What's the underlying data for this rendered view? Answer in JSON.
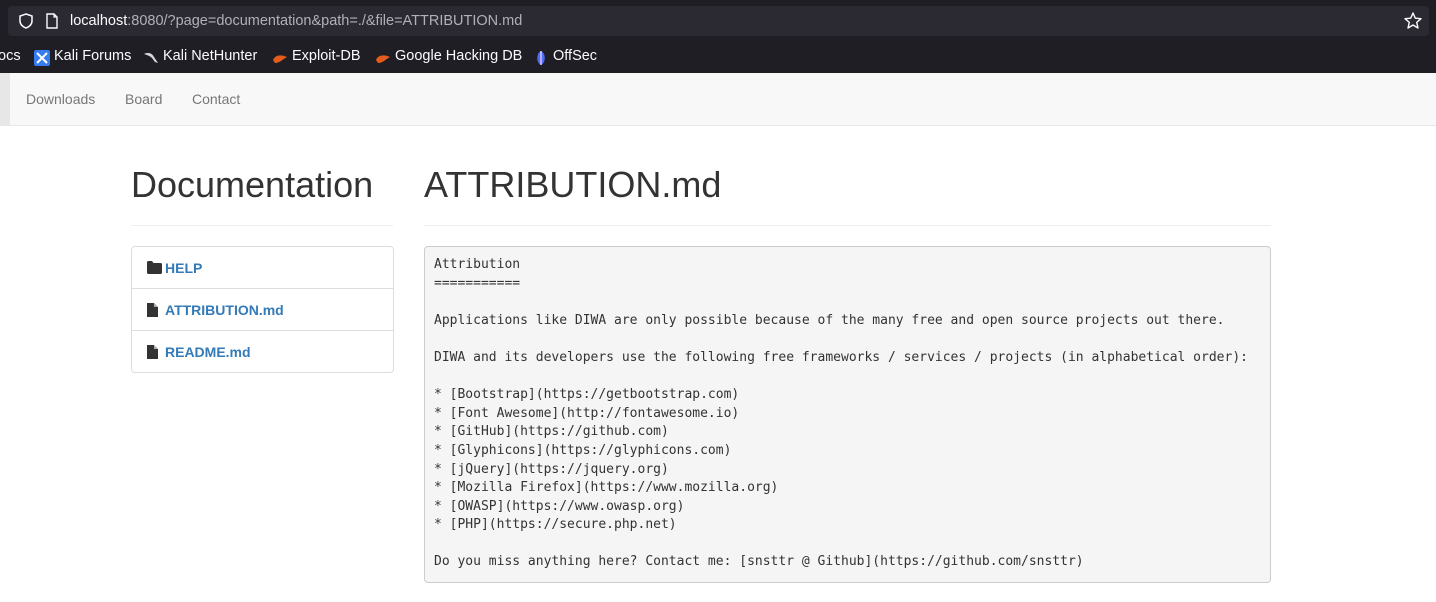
{
  "browser": {
    "url_host": "localhost",
    "url_rest": ":8080/?page=documentation&path=./&file=ATTRIBUTION.md",
    "bookmarks": [
      {
        "label": "ocs",
        "icon": "none"
      },
      {
        "label": "Kali Forums",
        "icon": "kali-forums-icon"
      },
      {
        "label": "Kali NetHunter",
        "icon": "nethunter-icon"
      },
      {
        "label": "Exploit-DB",
        "icon": "exploitdb-icon"
      },
      {
        "label": "Google Hacking DB",
        "icon": "ghdb-icon"
      },
      {
        "label": "OffSec",
        "icon": "offsec-icon"
      }
    ]
  },
  "navbar": {
    "links": [
      "Downloads",
      "Board",
      "Contact"
    ]
  },
  "sidebar": {
    "title": "Documentation",
    "items": [
      {
        "label": "HELP",
        "icon": "folder-icon"
      },
      {
        "label": "ATTRIBUTION.md",
        "icon": "file-icon"
      },
      {
        "label": "README.md",
        "icon": "file-icon"
      }
    ]
  },
  "main": {
    "file_title": "ATTRIBUTION.md",
    "content_lines": [
      "Attribution",
      "===========",
      "",
      "Applications like DIWA are only possible because of the many free and open source projects out there.",
      "",
      "DIWA and its developers use the following free frameworks / services / projects (in alphabetical order):",
      "",
      "* [Bootstrap](https://getbootstrap.com)",
      "* [Font Awesome](http://fontawesome.io)",
      "* [GitHub](https://github.com)",
      "* [Glyphicons](https://glyphicons.com)",
      "* [jQuery](https://jquery.org)",
      "* [Mozilla Firefox](https://www.mozilla.org)",
      "* [OWASP](https://www.owasp.org)",
      "* [PHP](https://secure.php.net)",
      "",
      "Do you miss anything here? Contact me: [snsttr @ Github](https://github.com/snsttr)"
    ]
  },
  "colors": {
    "link": "#337ab7",
    "chrome_bg": "#1f1e25",
    "urlbar_bg": "#2b2a33",
    "navbar_bg": "#f8f8f8",
    "pre_bg": "#f5f5f5"
  }
}
